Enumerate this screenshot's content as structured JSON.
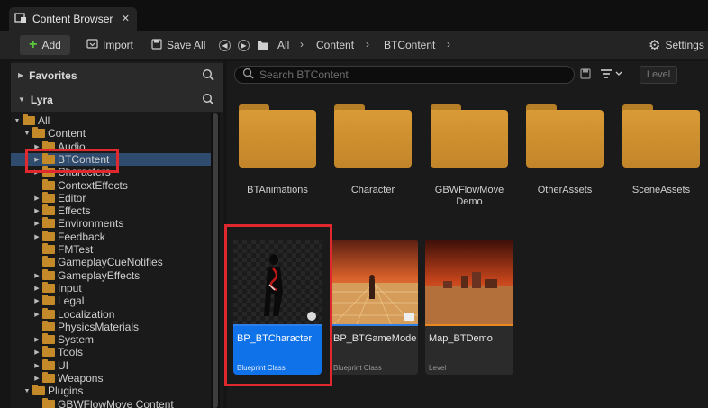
{
  "tab": {
    "title": "Content Browser",
    "close": "✕"
  },
  "toolbar": {
    "add_label": "Add",
    "import_label": "Import",
    "saveall_label": "Save All",
    "settings_label": "Settings"
  },
  "breadcrumb": [
    "All",
    "Content",
    "BTContent"
  ],
  "sidebar": {
    "favorites_label": "Favorites",
    "project_label": "Lyra",
    "tree": [
      {
        "label": "All",
        "depth": 0,
        "arrow": "▼",
        "open": true
      },
      {
        "label": "Content",
        "depth": 1,
        "arrow": "▼",
        "open": true
      },
      {
        "label": "Audio",
        "depth": 2,
        "arrow": "▶"
      },
      {
        "label": "BTContent",
        "depth": 2,
        "arrow": "▶",
        "selected": true
      },
      {
        "label": "Characters",
        "depth": 2,
        "arrow": "▶"
      },
      {
        "label": "ContextEffects",
        "depth": 2,
        "arrow": ""
      },
      {
        "label": "Editor",
        "depth": 2,
        "arrow": "▶"
      },
      {
        "label": "Effects",
        "depth": 2,
        "arrow": "▶"
      },
      {
        "label": "Environments",
        "depth": 2,
        "arrow": "▶"
      },
      {
        "label": "Feedback",
        "depth": 2,
        "arrow": "▶"
      },
      {
        "label": "FMTest",
        "depth": 2,
        "arrow": ""
      },
      {
        "label": "GameplayCueNotifies",
        "depth": 2,
        "arrow": ""
      },
      {
        "label": "GameplayEffects",
        "depth": 2,
        "arrow": "▶"
      },
      {
        "label": "Input",
        "depth": 2,
        "arrow": "▶"
      },
      {
        "label": "Legal",
        "depth": 2,
        "arrow": "▶"
      },
      {
        "label": "Localization",
        "depth": 2,
        "arrow": "▶"
      },
      {
        "label": "PhysicsMaterials",
        "depth": 2,
        "arrow": ""
      },
      {
        "label": "System",
        "depth": 2,
        "arrow": "▶"
      },
      {
        "label": "Tools",
        "depth": 2,
        "arrow": "▶"
      },
      {
        "label": "UI",
        "depth": 2,
        "arrow": "▶"
      },
      {
        "label": "Weapons",
        "depth": 2,
        "arrow": "▶"
      },
      {
        "label": "Plugins",
        "depth": 1,
        "arrow": "▼",
        "open": true
      },
      {
        "label": "GBWFlowMove Content",
        "depth": 2,
        "arrow": ""
      }
    ]
  },
  "search": {
    "placeholder": "Search BTContent"
  },
  "level_filter": "Level",
  "folders": [
    {
      "name": "BTAnimations"
    },
    {
      "name": "Character"
    },
    {
      "name": "GBWFlowMove\nDemo"
    },
    {
      "name": "OtherAssets"
    },
    {
      "name": "SceneAssets"
    }
  ],
  "assets": [
    {
      "name": "BP_BTCharacter",
      "type": "Blueprint Class",
      "selected": true
    },
    {
      "name": "BP_BTGameMode",
      "type": "Blueprint Class"
    },
    {
      "name": "Map_BTDemo",
      "type": "Level"
    }
  ],
  "colors": {
    "accent": "#0f72e8",
    "folder": "#d99b35",
    "highlight": "#e0282e",
    "blueprint_bar": "#2f7fe8",
    "level_bar": "#e8881e"
  }
}
